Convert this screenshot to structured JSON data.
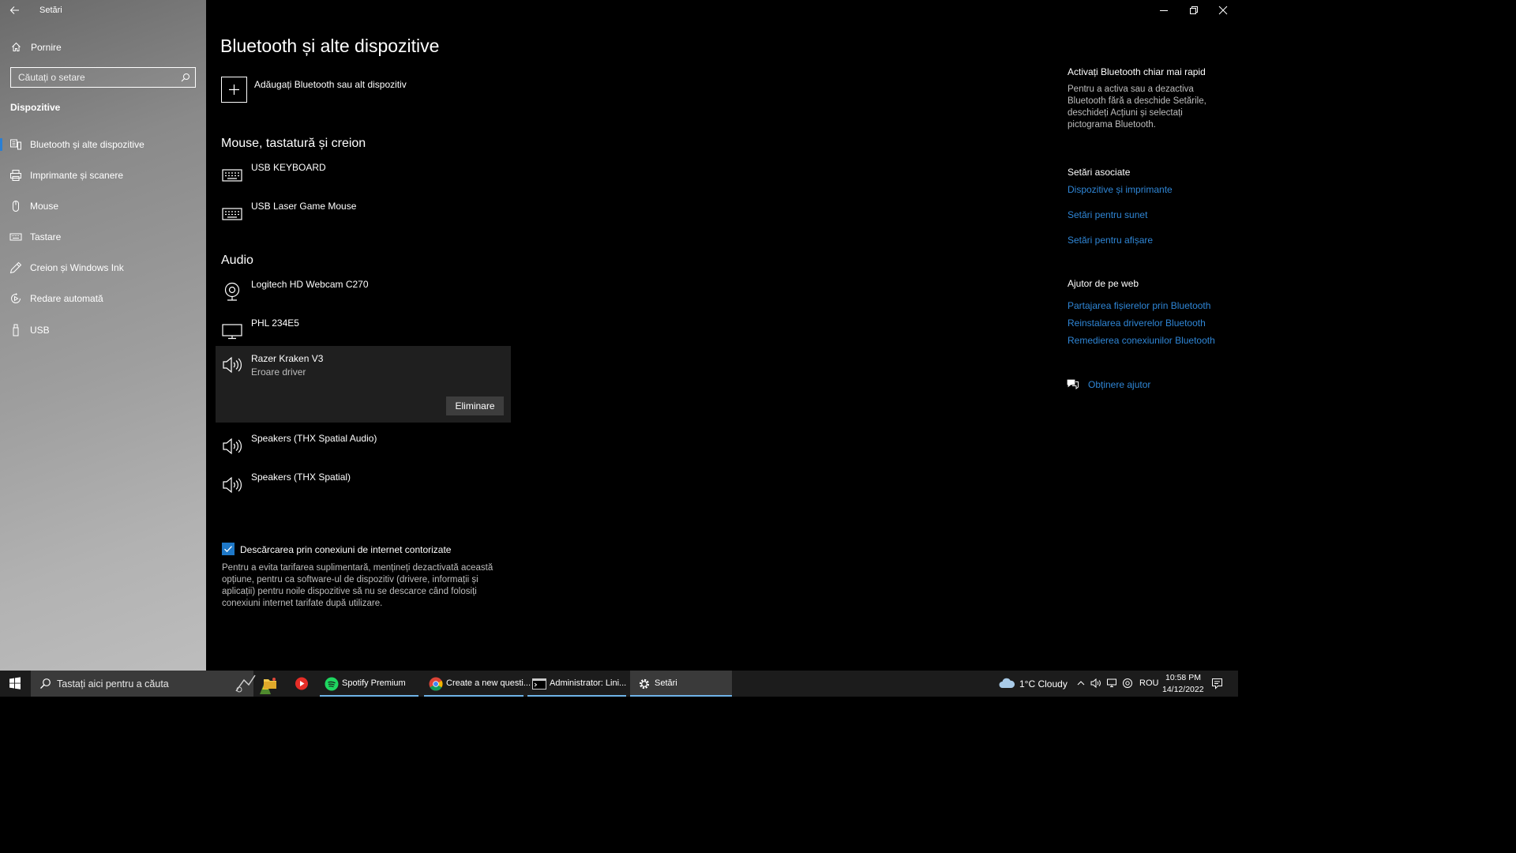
{
  "window": {
    "title": "Setări"
  },
  "sidebar": {
    "home_label": "Pornire",
    "search_placeholder": "Căutați o setare",
    "section_title": "Dispozitive",
    "items": [
      {
        "label": "Bluetooth și alte dispozitive",
        "icon": "bluetooth-devices-icon",
        "active": true
      },
      {
        "label": "Imprimante și scanere",
        "icon": "printer-icon"
      },
      {
        "label": "Mouse",
        "icon": "mouse-icon"
      },
      {
        "label": "Tastare",
        "icon": "keyboard-icon"
      },
      {
        "label": "Creion și Windows Ink",
        "icon": "pen-icon"
      },
      {
        "label": "Redare automată",
        "icon": "autoplay-icon"
      },
      {
        "label": "USB",
        "icon": "usb-icon"
      }
    ]
  },
  "main": {
    "title": "Bluetooth și alte dispozitive",
    "add_device_label": "Adăugați Bluetooth sau alt dispozitiv",
    "groups": [
      {
        "heading": "Mouse, tastatură și creion",
        "devices": [
          {
            "name": "USB KEYBOARD",
            "icon": "keyboard-icon"
          },
          {
            "name": "USB Laser Game Mouse",
            "icon": "keyboard-icon"
          }
        ]
      },
      {
        "heading": "Audio",
        "devices": [
          {
            "name": "Logitech HD Webcam C270",
            "icon": "webcam-icon"
          },
          {
            "name": "PHL 234E5",
            "icon": "monitor-icon"
          },
          {
            "name": "Razer Kraken V3",
            "status": "Eroare driver",
            "icon": "speaker-icon",
            "selected": true,
            "remove_label": "Eliminare"
          },
          {
            "name": "Speakers (THX Spatial Audio)",
            "icon": "speaker-icon"
          },
          {
            "name": "Speakers (THX Spatial)",
            "icon": "speaker-icon"
          }
        ]
      }
    ],
    "metered": {
      "label": "Descărcarea prin conexiuni de internet contorizate",
      "checked": true,
      "description": "Pentru a evita tarifarea suplimentară, mențineți dezactivată această opțiune, pentru ca software-ul de dispozitiv (drivere, informații și aplicații) pentru noile dispozitive să nu se descarce când folosiți conexiuni internet tarifate după utilizare."
    }
  },
  "right_panel": {
    "quick_heading": "Activați Bluetooth chiar mai rapid",
    "quick_text": "Pentru a activa sau a dezactiva Bluetooth fără a deschide Setările, deschideți Acțiuni și selectați pictograma Bluetooth.",
    "related_heading": "Setări asociate",
    "related_links": [
      "Dispozitive și imprimante",
      "Setări pentru sunet",
      "Setări pentru afișare"
    ],
    "web_heading": "Ajutor de pe web",
    "web_links": [
      "Partajarea fișierelor prin Bluetooth",
      "Reinstalarea driverelor Bluetooth",
      "Remedierea conexiunilor Bluetooth"
    ],
    "help_label": "Obținere ajutor"
  },
  "taskbar": {
    "search_placeholder": "Tastați aici pentru a căuta",
    "apps": [
      {
        "label": "Spotify Premium",
        "icon": "spotify-icon"
      },
      {
        "label": "Create a new questi...",
        "icon": "chrome-icon"
      },
      {
        "label": "Administrator: Lini...",
        "icon": "terminal-icon"
      },
      {
        "label": "Setări",
        "icon": "gear-icon",
        "active": true
      }
    ],
    "weather": "1°C  Cloudy",
    "language": "ROU",
    "time": "10:58 PM",
    "date": "14/12/2022"
  },
  "colors": {
    "accent": "#1e78c8",
    "link": "#2f86d6",
    "selected_bg": "#1f1f1f"
  }
}
